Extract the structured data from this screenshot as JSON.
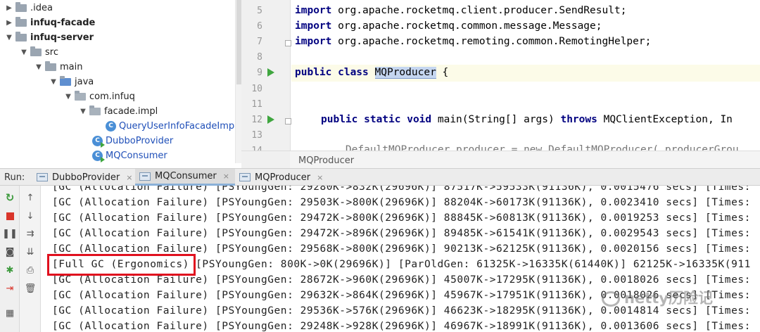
{
  "tree": {
    "items": [
      {
        "label": ".idea",
        "bold": false
      },
      {
        "label": "infuq-facade",
        "bold": true
      },
      {
        "label": "infuq-server",
        "bold": true
      },
      {
        "label": "src",
        "bold": false
      },
      {
        "label": "main",
        "bold": false
      },
      {
        "label": "java",
        "bold": false
      },
      {
        "label": "com.infuq",
        "bold": false
      },
      {
        "label": "facade.impl",
        "bold": false
      },
      {
        "label": "QueryUserInfoFacadeImpl",
        "bold": false
      },
      {
        "label": "DubboProvider",
        "bold": false
      },
      {
        "label": "MQConsumer",
        "bold": false
      }
    ],
    "class_icon_letter": "C"
  },
  "editor": {
    "line_numbers": [
      "5",
      "6",
      "7",
      "8",
      "9",
      "10",
      "11",
      "12",
      "13",
      "14"
    ],
    "line5_kw": "import",
    "line5_rest": " org.apache.rocketmq.client.producer.SendResult;",
    "line6_kw": "import",
    "line6_rest": " org.apache.rocketmq.common.message.Message;",
    "line7_kw": "import",
    "line7_rest": " org.apache.rocketmq.remoting.common.RemotingHelper;",
    "line9_kw": "public class",
    "line9_sel": "MQProducer",
    "line9_rest": " {",
    "line12_kw1": "public static void",
    "line12_mid": " main(String[] args) ",
    "line12_kw2": "throws",
    "line12_rest": " MQClientException, In",
    "line14_text": "    DefaultMQProducer producer = new DefaultMQProducer( producerGrou",
    "breadcrumb": "MQProducer"
  },
  "run": {
    "label": "Run:",
    "tabs": [
      {
        "label": "DubboProvider",
        "close": "×"
      },
      {
        "label": "MQConsumer",
        "close": "×"
      },
      {
        "label": "MQProducer",
        "close": "×"
      }
    ]
  },
  "console": {
    "lines": [
      "[GC (Allocation Failure) [PSYoungGen: 29280K->832K(29696K)] 87517K->59533K(91136K), 0.0015476 secs] [Times:",
      "[GC (Allocation Failure) [PSYoungGen: 29503K->800K(29696K)] 88204K->60173K(91136K), 0.0023410 secs] [Times:",
      "[GC (Allocation Failure) [PSYoungGen: 29472K->800K(29696K)] 88845K->60813K(91136K), 0.0019253 secs] [Times:",
      "[GC (Allocation Failure) [PSYoungGen: 29472K->896K(29696K)] 89485K->61541K(91136K), 0.0029543 secs] [Times:",
      "[GC (Allocation Failure) [PSYoungGen: 29568K->800K(29696K)] 90213K->62125K(91136K), 0.0020156 secs] [Times:",
      "[Full GC (Ergonomics) [PSYoungGen: 800K->0K(29696K)] [ParOldGen: 61325K->16335K(61440K)] 62125K->16335K(911",
      "[GC (Allocation Failure) [PSYoungGen: 28672K->960K(29696K)] 45007K->17295K(91136K), 0.0018026 secs] [Times:",
      "[GC (Allocation Failure) [PSYoungGen: 29632K->864K(29696K)] 45967K->17951K(91136K), 0.0018026 secs] [Times:",
      "[GC (Allocation Failure) [PSYoungGen: 29536K->576K(29696K)] 46623K->18295K(91136K), 0.0014814 secs] [Times:",
      "[GC (Allocation Failure) [PSYoungGen: 29248K->928K(29696K)] 46967K->18991K(91136K), 0.0013606 secs] [Times:"
    ],
    "highlight_color": "#e0101e"
  },
  "watermark": "netty历险记",
  "icons": {
    "rerun": "rerun-icon",
    "stop": "stop-icon",
    "pause": "pause-icon",
    "camera": "camera-icon",
    "up": "up-arrow-icon",
    "down": "down-arrow-icon",
    "wrap": "soft-wrap-icon",
    "scroll": "scroll-to-end-icon",
    "print": "print-icon",
    "trash": "clear-all-icon"
  }
}
